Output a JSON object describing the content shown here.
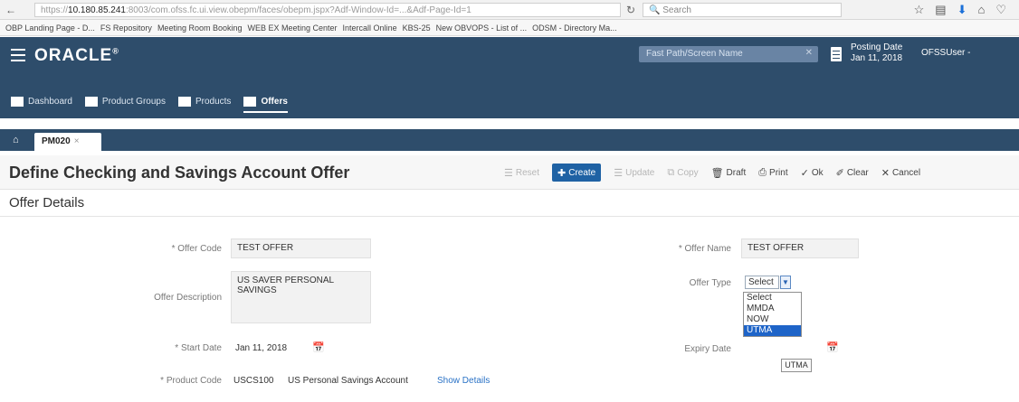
{
  "browser": {
    "url_prefix": "https://",
    "url_host": "10.180.85.241",
    "url_rest": ":8003/com.ofss.fc.ui.view.obepm/faces/obepm.jspx?Adf-Window-Id=...&Adf-Page-Id=1",
    "search_placeholder": "Search",
    "bookmarks": [
      "OBP Landing Page - D...",
      "FS Repository",
      "Meeting Room Booking",
      "WEB EX Meeting Center",
      "Intercall Online",
      "KBS-25",
      "New OBVOPS - List of ...",
      "ODSM - Directory Ma..."
    ]
  },
  "header": {
    "logo": "ORACLE",
    "logo_mark": "®",
    "fast_path_placeholder": "Fast Path/Screen Name",
    "posting_label": "Posting Date",
    "posting_date": "Jan 11, 2018",
    "user": "OFSSUser -"
  },
  "menu": {
    "items": [
      {
        "label": "Dashboard"
      },
      {
        "label": "Product Groups"
      },
      {
        "label": "Products"
      },
      {
        "label": "Offers"
      }
    ]
  },
  "tab": {
    "label": "PM020",
    "close": "×"
  },
  "page": {
    "title": "Define Checking and Savings Account Offer",
    "section": "Offer Details"
  },
  "toolbar": {
    "reset": "Reset",
    "create": "Create",
    "update": "Update",
    "copy": "Copy",
    "draft": "Draft",
    "print": "Print",
    "ok": "Ok",
    "clear": "Clear",
    "cancel": "Cancel"
  },
  "form": {
    "offer_code_label": "* Offer Code",
    "offer_code": "TEST OFFER",
    "offer_name_label": "* Offer Name",
    "offer_name": "TEST OFFER",
    "offer_description_label": "Offer Description",
    "offer_description": "US SAVER PERSONAL SAVINGS",
    "offer_type_label": "Offer Type",
    "offer_type_selected": "Select",
    "offer_type_options": [
      "Select",
      "MMDA",
      "NOW",
      "UTMA"
    ],
    "offer_type_highlighted": "UTMA",
    "start_date_label": "* Start Date",
    "start_date": "Jan 11, 2018",
    "expiry_date_label": "Expiry Date",
    "tooltip": "UTMA",
    "product_code_label": "* Product Code",
    "product_code": "USCS100",
    "product_name": "US Personal Savings Account",
    "show_details": "Show Details"
  }
}
